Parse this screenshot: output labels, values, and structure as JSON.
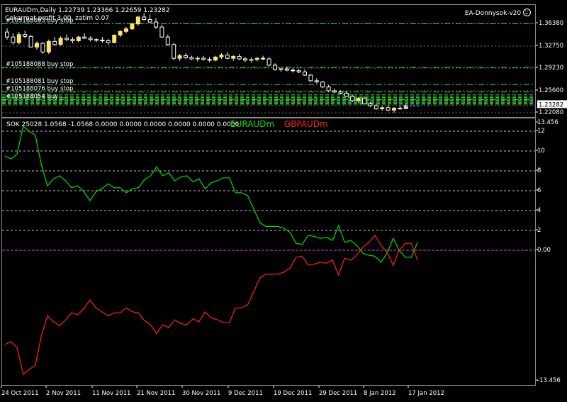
{
  "header": {
    "symbol_line": "EURAUDm,Daily  1.22739 1.23366 1.22659 1.23282",
    "comment_line": "Cekarmat profit 3.00, zatim 0.07",
    "ea_name": "EA-Donnysok-v20",
    "ea_icon": "smiley-icon"
  },
  "orders": [
    {
      "label": "#105188093 buy stop",
      "price": 1.3634
    },
    {
      "label": "#105188088 buy stop",
      "price": 1.2935
    },
    {
      "label": "#105188081 buy stop",
      "price": 1.266
    },
    {
      "label": "#105188076 buy stop",
      "price": 1.254
    },
    {
      "label": "#105188054 buy ...",
      "price": 1.242
    }
  ],
  "price_axis": {
    "labels": [
      "1.36380",
      "1.32750",
      "1.29230",
      "1.25600",
      "1.23282",
      "1.22080"
    ],
    "current": "1.23282"
  },
  "indicator": {
    "title": "SOK 25028 1.0568 -1.0568 0.0000 0.0000 0.0000 0.0000 0.0000 0.0000",
    "legend": [
      {
        "name": "EURAUDm",
        "color": "#00e000"
      },
      {
        "name": "GBPAUDm",
        "color": "#ff2020"
      }
    ],
    "axis_labels": [
      "13.456",
      "12",
      "10",
      "8",
      "6",
      "4",
      "2",
      "0.00",
      "-13.456"
    ],
    "ymin": -13.456,
    "ymax": 13.456,
    "series": [
      {
        "name": "EURAUDm",
        "color": "#00e000",
        "values": [
          9.5,
          9.2,
          9.7,
          12.5,
          12.0,
          11.6,
          8.6,
          6.5,
          7.2,
          7.5,
          7.0,
          6.3,
          6.5,
          5.9,
          5.0,
          5.9,
          6.2,
          6.7,
          6.3,
          6.3,
          5.8,
          6.2,
          6.3,
          7.1,
          7.5,
          8.4,
          7.5,
          7.8,
          7.0,
          7.4,
          7.5,
          6.9,
          7.2,
          6.2,
          6.8,
          7.0,
          7.3,
          7.3,
          5.8,
          5.8,
          5.5,
          4.2,
          2.8,
          2.4,
          2.4,
          2.4,
          2.2,
          1.8,
          0.7,
          0.6,
          1.5,
          1.4,
          1.2,
          1.3,
          1.0,
          2.5,
          0.8,
          1.0,
          0.5,
          -0.3,
          -0.5,
          -0.6,
          -1.2,
          -0.3,
          1.2,
          0.0,
          -0.7,
          -0.7,
          0.8
        ]
      },
      {
        "name": "GBPAUDm",
        "color": "#ff2020",
        "values": [
          -9.5,
          -9.2,
          -9.8,
          -12.5,
          -12.0,
          -11.6,
          -8.6,
          -6.6,
          -7.2,
          -7.6,
          -7.0,
          -6.3,
          -6.5,
          -5.9,
          -5.0,
          -5.8,
          -6.2,
          -6.6,
          -6.3,
          -6.3,
          -5.8,
          -6.2,
          -6.3,
          -7.1,
          -7.5,
          -8.4,
          -7.5,
          -7.8,
          -7.0,
          -7.4,
          -7.5,
          -6.9,
          -7.2,
          -6.2,
          -6.8,
          -7.0,
          -7.3,
          -7.3,
          -5.8,
          -5.8,
          -5.5,
          -4.2,
          -2.8,
          -2.4,
          -2.4,
          -2.4,
          -2.2,
          -1.8,
          -0.7,
          -0.6,
          -1.5,
          -1.4,
          -1.2,
          -1.3,
          -1.0,
          -2.5,
          -0.8,
          -1.0,
          -0.5,
          0.3,
          0.8,
          1.5,
          0.5,
          -0.2,
          -1.5,
          0.0,
          0.7,
          0.7,
          -1.0
        ]
      }
    ]
  },
  "candles": [
    [
      1.35,
      1.356,
      1.338,
      1.342
    ],
    [
      1.342,
      1.348,
      1.33,
      1.333
    ],
    [
      1.333,
      1.35,
      1.33,
      1.346
    ],
    [
      1.346,
      1.352,
      1.34,
      1.343
    ],
    [
      1.343,
      1.345,
      1.325,
      1.326
    ],
    [
      1.326,
      1.335,
      1.322,
      1.332
    ],
    [
      1.332,
      1.334,
      1.315,
      1.318
    ],
    [
      1.318,
      1.338,
      1.315,
      1.335
    ],
    [
      1.335,
      1.342,
      1.328,
      1.33
    ],
    [
      1.33,
      1.343,
      1.328,
      1.34
    ],
    [
      1.34,
      1.346,
      1.335,
      1.338
    ],
    [
      1.338,
      1.342,
      1.332,
      1.336
    ],
    [
      1.336,
      1.344,
      1.334,
      1.342
    ],
    [
      1.342,
      1.348,
      1.339,
      1.34
    ],
    [
      1.34,
      1.343,
      1.335,
      1.338
    ],
    [
      1.338,
      1.34,
      1.334,
      1.337
    ],
    [
      1.337,
      1.342,
      1.333,
      1.336
    ],
    [
      1.336,
      1.339,
      1.33,
      1.333
    ],
    [
      1.333,
      1.346,
      1.332,
      1.345
    ],
    [
      1.345,
      1.353,
      1.342,
      1.351
    ],
    [
      1.351,
      1.358,
      1.348,
      1.355
    ],
    [
      1.355,
      1.365,
      1.353,
      1.363
    ],
    [
      1.363,
      1.376,
      1.36,
      1.374
    ],
    [
      1.374,
      1.38,
      1.368,
      1.37
    ],
    [
      1.37,
      1.378,
      1.365,
      1.366
    ],
    [
      1.366,
      1.372,
      1.355,
      1.358
    ],
    [
      1.358,
      1.362,
      1.34,
      1.342
    ],
    [
      1.342,
      1.346,
      1.328,
      1.33
    ],
    [
      1.33,
      1.333,
      1.305,
      1.308
    ],
    [
      1.308,
      1.315,
      1.304,
      1.312
    ],
    [
      1.312,
      1.316,
      1.306,
      1.309
    ],
    [
      1.309,
      1.312,
      1.305,
      1.307
    ],
    [
      1.307,
      1.311,
      1.303,
      1.308
    ],
    [
      1.308,
      1.312,
      1.304,
      1.306
    ],
    [
      1.306,
      1.31,
      1.302,
      1.305
    ],
    [
      1.305,
      1.312,
      1.303,
      1.31
    ],
    [
      1.31,
      1.316,
      1.307,
      1.313
    ],
    [
      1.313,
      1.318,
      1.306,
      1.308
    ],
    [
      1.308,
      1.313,
      1.304,
      1.311
    ],
    [
      1.311,
      1.315,
      1.305,
      1.307
    ],
    [
      1.307,
      1.31,
      1.302,
      1.305
    ],
    [
      1.305,
      1.309,
      1.301,
      1.306
    ],
    [
      1.306,
      1.31,
      1.303,
      1.308
    ],
    [
      1.308,
      1.312,
      1.305,
      1.307
    ],
    [
      1.307,
      1.31,
      1.295,
      1.297
    ],
    [
      1.297,
      1.3,
      1.288,
      1.29
    ],
    [
      1.29,
      1.294,
      1.286,
      1.291
    ],
    [
      1.291,
      1.295,
      1.287,
      1.289
    ],
    [
      1.289,
      1.292,
      1.285,
      1.288
    ],
    [
      1.288,
      1.291,
      1.284,
      1.286
    ],
    [
      1.286,
      1.29,
      1.28,
      1.281
    ],
    [
      1.281,
      1.283,
      1.27,
      1.272
    ],
    [
      1.272,
      1.276,
      1.268,
      1.27
    ],
    [
      1.27,
      1.272,
      1.26,
      1.262
    ],
    [
      1.262,
      1.265,
      1.254,
      1.256
    ],
    [
      1.256,
      1.26,
      1.252,
      1.254
    ],
    [
      1.254,
      1.257,
      1.25,
      1.252
    ],
    [
      1.252,
      1.256,
      1.246,
      1.247
    ],
    [
      1.247,
      1.25,
      1.238,
      1.24
    ],
    [
      1.24,
      1.246,
      1.236,
      1.244
    ],
    [
      1.244,
      1.247,
      1.234,
      1.235
    ],
    [
      1.235,
      1.238,
      1.23,
      1.232
    ],
    [
      1.232,
      1.235,
      1.225,
      1.227
    ],
    [
      1.227,
      1.231,
      1.224,
      1.229
    ],
    [
      1.229,
      1.233,
      1.223,
      1.225
    ],
    [
      1.225,
      1.23,
      1.221,
      1.228
    ],
    [
      1.228,
      1.232,
      1.226,
      1.2274
    ],
    [
      1.2274,
      1.2337,
      1.2266,
      1.2328
    ]
  ],
  "time_axis": [
    "24 Oct 2011",
    "2 Nov 2011",
    "11 Nov 2011",
    "21 Nov 2011",
    "30 Nov 2011",
    "9 Dec 2011",
    "19 Dec 2011",
    "29 Dec 2011",
    "8 Jan 2012",
    "17 Jan 2012"
  ],
  "colors": {
    "background": "#000000",
    "grid": "#c0c0c0",
    "order_line": "#32cd32",
    "bull_candle": "#ffe070",
    "bear_candle": "#ffffff",
    "zero_line": "#e040e0",
    "current_price_bg": "#ffffff"
  }
}
